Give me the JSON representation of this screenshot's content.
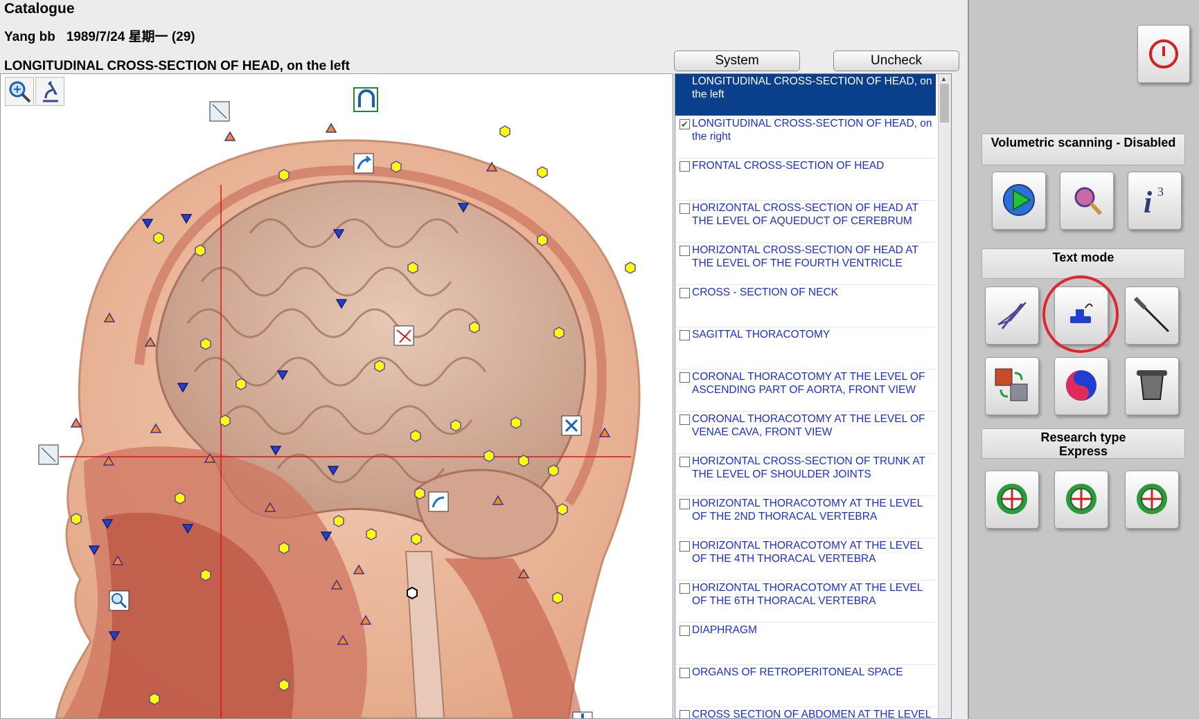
{
  "header": {
    "title": "Catalogue",
    "patient": "Yang bb   1989/7/24 星期一 (29)",
    "section": "LONGITUDINAL CROSS-SECTION OF HEAD, on the left"
  },
  "buttons": {
    "system": "System",
    "uncheck": "Uncheck"
  },
  "catalog": {
    "items": [
      {
        "label": "LONGITUDINAL CROSS-SECTION OF HEAD, on the left",
        "selected": true
      },
      {
        "label": "LONGITUDINAL CROSS-SECTION OF HEAD,  on the right",
        "checked": true
      },
      {
        "label": "FRONTAL CROSS-SECTION OF HEAD"
      },
      {
        "label": "HORIZONTAL CROSS-SECTION OF HEAD AT THE LEVEL OF AQUEDUCT OF CEREBRUM"
      },
      {
        "label": "HORIZONTAL CROSS-SECTION OF HEAD AT THE LEVEL OF THE FOURTH VENTRICLE"
      },
      {
        "label": "CROSS - SECTION OF NECK"
      },
      {
        "label": "SAGITTAL THORACOTOMY"
      },
      {
        "label": "CORONAL THORACOTOMY AT THE LEVEL OF ASCENDING PART OF AORTA, FRONT VIEW"
      },
      {
        "label": "CORONAL THORACOTOMY AT THE LEVEL OF VENAE CAVA, FRONT VIEW"
      },
      {
        "label": "HORIZONTAL CROSS-SECTION OF TRUNK AT THE LEVEL OF SHOULDER JOINTS"
      },
      {
        "label": "HORIZONTAL THORACOTOMY AT THE LEVEL OF THE 2ND THORACAL VERTEBRA"
      },
      {
        "label": "HORIZONTAL THORACOTOMY AT THE LEVEL OF THE 4TH THORACAL VERTEBRA"
      },
      {
        "label": "HORIZONTAL THORACOTOMY AT THE LEVEL OF THE 6TH THORACAL VERTEBRA"
      },
      {
        "label": "DIAPHRAGM"
      },
      {
        "label": "ORGANS OF RETROPERITONEAL SPACE"
      },
      {
        "label": "CROSS SECTION OF ABDOMEN AT THE LEVEL OF"
      }
    ]
  },
  "right_panel": {
    "volumetric": "Volumetric scanning - Disabled",
    "text_mode": "Text mode",
    "research_type": "Research type",
    "research_value": "Express"
  },
  "colors": {
    "selection": "#0a3f8c",
    "link": "#1a2fd6",
    "highlight": "#e0262a",
    "marker_yellow": "#ffff00"
  },
  "icons": [
    "zoom-in-icon",
    "microscope-icon",
    "power-icon",
    "play-icon",
    "scan-icon",
    "info-icon",
    "quill-icon",
    "stamp-icon",
    "needle-icon",
    "transform-icon",
    "yin-yang-icon",
    "cauldron-icon",
    "target-icon"
  ]
}
